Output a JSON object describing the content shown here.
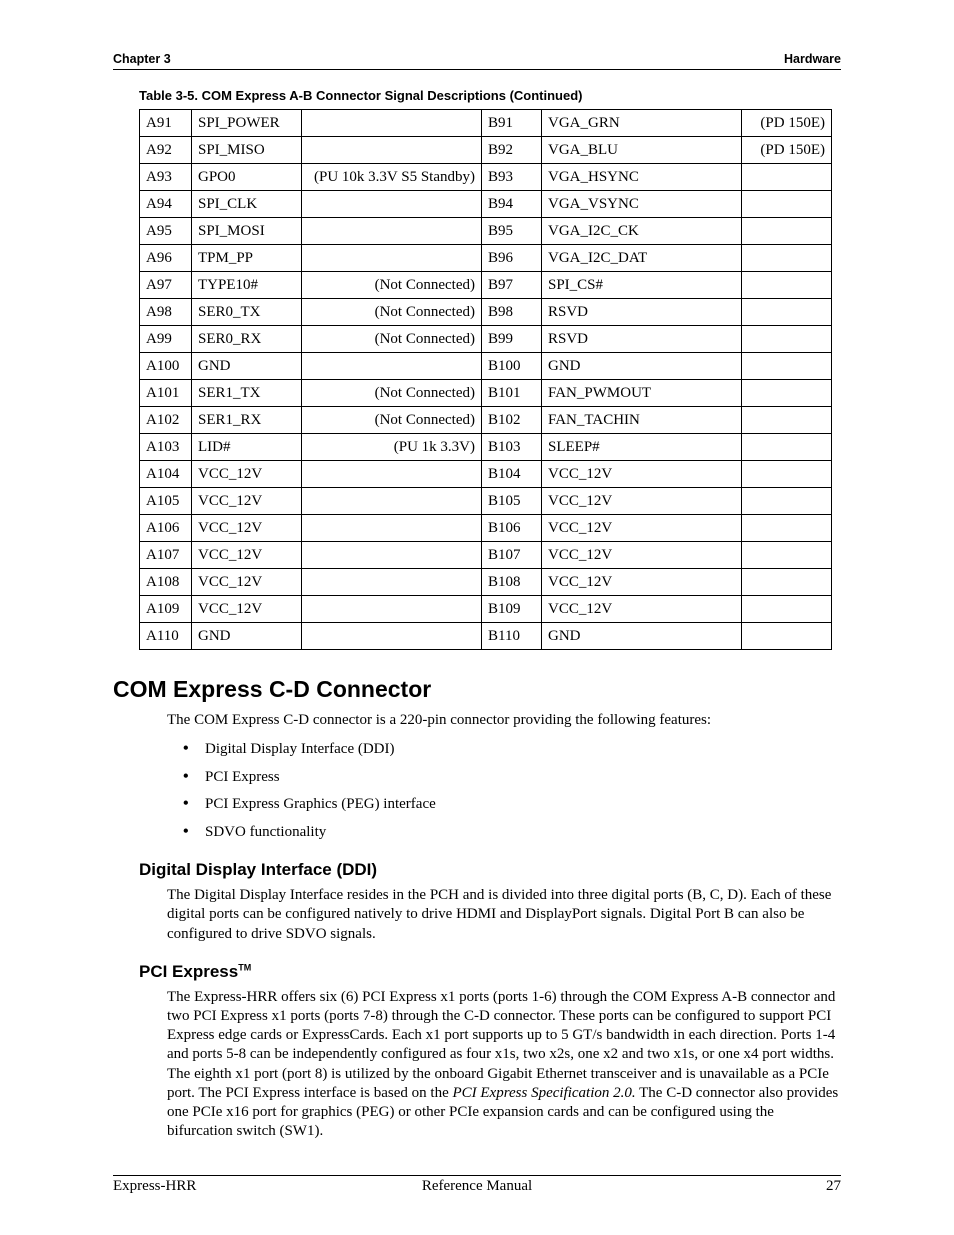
{
  "header": {
    "left": "Chapter 3",
    "right": "Hardware"
  },
  "table_caption": "Table 3-5.  COM Express A-B Connector Signal Descriptions (Continued)",
  "rows": [
    {
      "pa": "A91",
      "sa": "SPI_POWER",
      "na": "",
      "pb": "B91",
      "sb": "VGA_GRN",
      "nb": "(PD 150E)"
    },
    {
      "pa": "A92",
      "sa": "SPI_MISO",
      "na": "",
      "pb": "B92",
      "sb": "VGA_BLU",
      "nb": "(PD 150E)"
    },
    {
      "pa": "A93",
      "sa": "GPO0",
      "na": "(PU 10k 3.3V S5 Standby)",
      "pb": "B93",
      "sb": "VGA_HSYNC",
      "nb": ""
    },
    {
      "pa": "A94",
      "sa": "SPI_CLK",
      "na": "",
      "pb": "B94",
      "sb": "VGA_VSYNC",
      "nb": ""
    },
    {
      "pa": "A95",
      "sa": "SPI_MOSI",
      "na": "",
      "pb": "B95",
      "sb": "VGA_I2C_CK",
      "nb": ""
    },
    {
      "pa": "A96",
      "sa": "TPM_PP",
      "na": "",
      "pb": "B96",
      "sb": "VGA_I2C_DAT",
      "nb": ""
    },
    {
      "pa": "A97",
      "sa": "TYPE10#",
      "na": "(Not Connected)",
      "pb": "B97",
      "sb": "SPI_CS#",
      "nb": ""
    },
    {
      "pa": "A98",
      "sa": "SER0_TX",
      "na": "(Not Connected)",
      "pb": "B98",
      "sb": "RSVD",
      "nb": ""
    },
    {
      "pa": "A99",
      "sa": "SER0_RX",
      "na": "(Not Connected)",
      "pb": "B99",
      "sb": "RSVD",
      "nb": ""
    },
    {
      "pa": "A100",
      "sa": "GND",
      "na": "",
      "pb": "B100",
      "sb": "GND",
      "nb": ""
    },
    {
      "pa": "A101",
      "sa": "SER1_TX",
      "na": "(Not Connected)",
      "pb": "B101",
      "sb": "FAN_PWMOUT",
      "nb": ""
    },
    {
      "pa": "A102",
      "sa": "SER1_RX",
      "na": "(Not Connected)",
      "pb": "B102",
      "sb": "FAN_TACHIN",
      "nb": ""
    },
    {
      "pa": "A103",
      "sa": "LID#",
      "na": "(PU 1k 3.3V)",
      "pb": "B103",
      "sb": "SLEEP#",
      "nb": ""
    },
    {
      "pa": "A104",
      "sa": "VCC_12V",
      "na": "",
      "pb": "B104",
      "sb": "VCC_12V",
      "nb": ""
    },
    {
      "pa": "A105",
      "sa": "VCC_12V",
      "na": "",
      "pb": "B105",
      "sb": "VCC_12V",
      "nb": ""
    },
    {
      "pa": "A106",
      "sa": "VCC_12V",
      "na": "",
      "pb": "B106",
      "sb": "VCC_12V",
      "nb": ""
    },
    {
      "pa": "A107",
      "sa": "VCC_12V",
      "na": "",
      "pb": "B107",
      "sb": "VCC_12V",
      "nb": ""
    },
    {
      "pa": "A108",
      "sa": "VCC_12V",
      "na": "",
      "pb": "B108",
      "sb": "VCC_12V",
      "nb": ""
    },
    {
      "pa": "A109",
      "sa": "VCC_12V",
      "na": "",
      "pb": "B109",
      "sb": "VCC_12V",
      "nb": ""
    },
    {
      "pa": "A110",
      "sa": "GND",
      "na": "",
      "pb": "B110",
      "sb": "GND",
      "nb": ""
    }
  ],
  "section_heading": "COM Express C-D Connector",
  "intro_para": "The COM Express C-D connector is a 220-pin connector providing the following features:",
  "features": [
    "Digital Display Interface (DDI)",
    "PCI Express",
    "PCI Express Graphics (PEG) interface",
    "SDVO functionality"
  ],
  "sub1_heading": "Digital Display Interface (DDI)",
  "sub1_para": "The Digital Display Interface resides in the PCH and is divided into three digital ports (B, C, D). Each of these digital ports can be configured natively to drive HDMI and DisplayPort signals. Digital Port B can also be configured to drive SDVO signals.",
  "sub2_heading": "PCI Express",
  "sub2_tm": "TM",
  "sub2_para_pre": "The Express-HRR offers six (6) PCI Express x1 ports (ports 1-6) through the COM  Express A-B connector and two PCI Express x1 ports (ports 7-8) through the C-D connector. These ports can be configured to support PCI Express edge cards or ExpressCards. Each x1 port supports up to 5 GT/s bandwidth in each direction. Ports 1-4 and ports 5-8 can be independently configured as four x1s, two x2s, one x2 and two x1s, or one x4 port widths. The eighth x1 port (port 8) is utilized by the onboard Gigabit Ethernet transceiver and is unavailable as a PCIe port. The PCI Express interface is based on the ",
  "sub2_para_italic": "PCI Express Specification 2.0.",
  "sub2_para_post": "  The C-D connector also provides one PCIe x16 port for graphics (PEG) or other PCIe expansion cards and can be configured using the bifurcation switch (SW1).",
  "footer": {
    "left": "Express-HRR",
    "center": "Reference Manual",
    "right": "27"
  }
}
